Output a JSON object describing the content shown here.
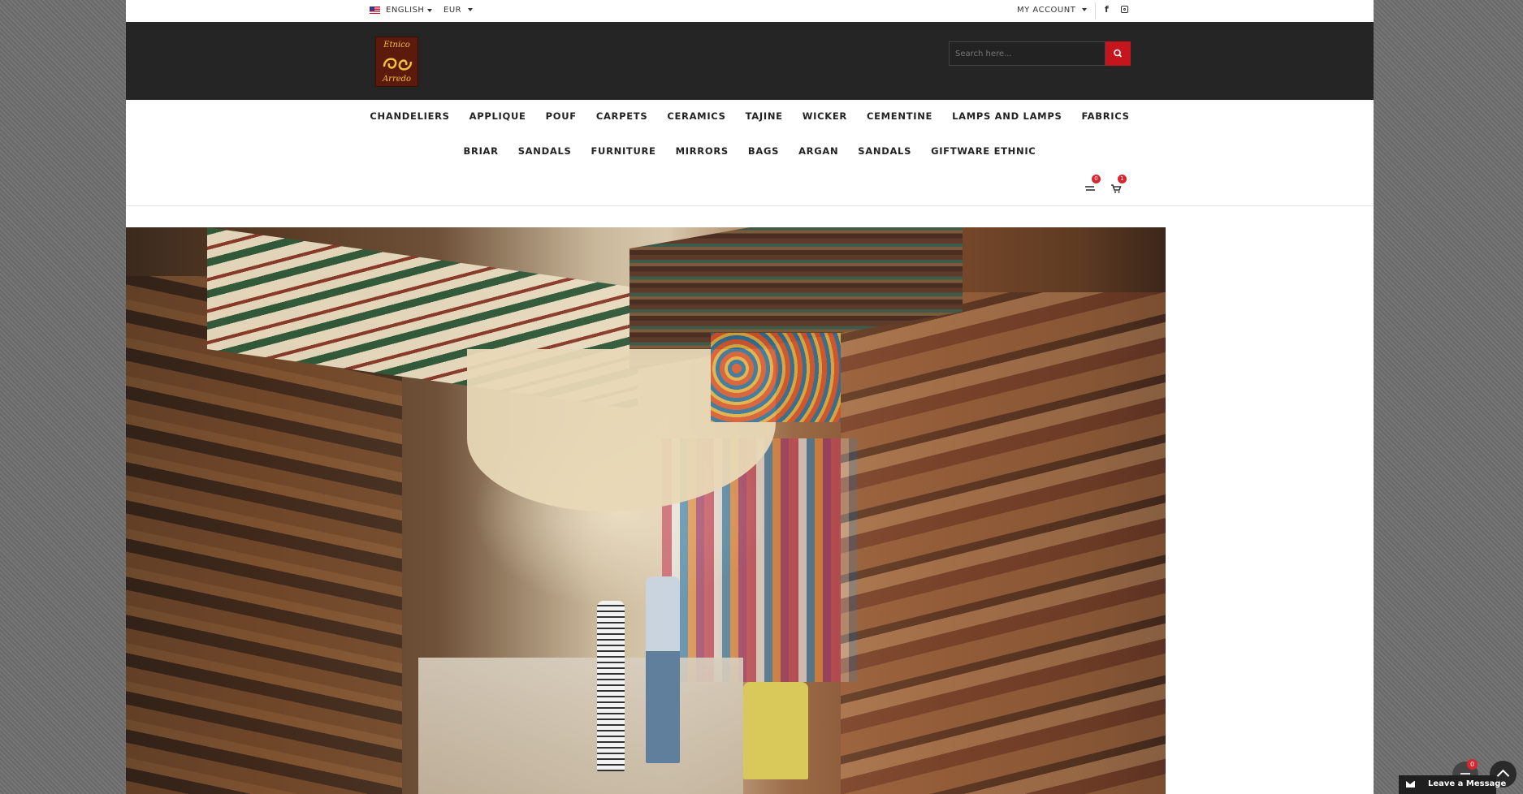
{
  "topbar": {
    "language": "ENGLISH",
    "currency": "EUR",
    "account": "MY ACCOUNT"
  },
  "header": {
    "logo_text_top": "Etnico",
    "logo_text_bottom": "Arredo",
    "search_placeholder": "Search here..."
  },
  "nav": {
    "row1": [
      "CHANDELIERS",
      "APPLIQUE",
      "POUF",
      "CARPETS",
      "CERAMICS",
      "TAJINE",
      "WICKER",
      "CEMENTINE",
      "LAMPS AND LAMPS",
      "FABRICS"
    ],
    "row2": [
      "BRIAR",
      "SANDALS",
      "FURNITURE",
      "MIRRORS",
      "BAGS",
      "ARGAN",
      "SANDALS",
      "GIFTWARE ETHNIC"
    ]
  },
  "counters": {
    "compare": "0",
    "cart": "1",
    "floating_compare": "0"
  },
  "chat": {
    "label": "Leave a Message"
  },
  "colors": {
    "accent": "#c5161d",
    "header_bg": "#252525",
    "badge": "#d9252d"
  },
  "icons": [
    "flag-us-icon",
    "facebook-icon",
    "instagram-icon",
    "search-icon",
    "compare-icon",
    "cart-icon",
    "mail-icon",
    "arrow-up-icon"
  ]
}
